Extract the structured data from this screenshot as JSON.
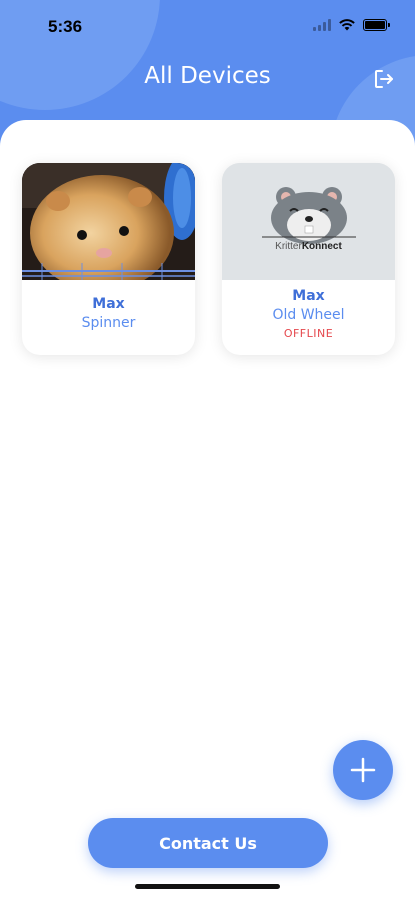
{
  "status_bar": {
    "time": "5:36"
  },
  "header": {
    "title": "All Devices"
  },
  "devices": [
    {
      "name": "Max",
      "device": "Spinner",
      "status": ""
    },
    {
      "name": "Max",
      "device": "Old Wheel",
      "status": "OFFLINE"
    }
  ],
  "placeholder_logo": {
    "text_light": "Kritter",
    "text_bold": "Konnect"
  },
  "actions": {
    "contact_label": "Contact Us"
  },
  "colors": {
    "primary": "#5b8def",
    "offline": "#e5484d"
  },
  "icons": [
    "logout-icon",
    "plus-icon",
    "wifi-icon",
    "battery-icon",
    "signal-icon"
  ]
}
